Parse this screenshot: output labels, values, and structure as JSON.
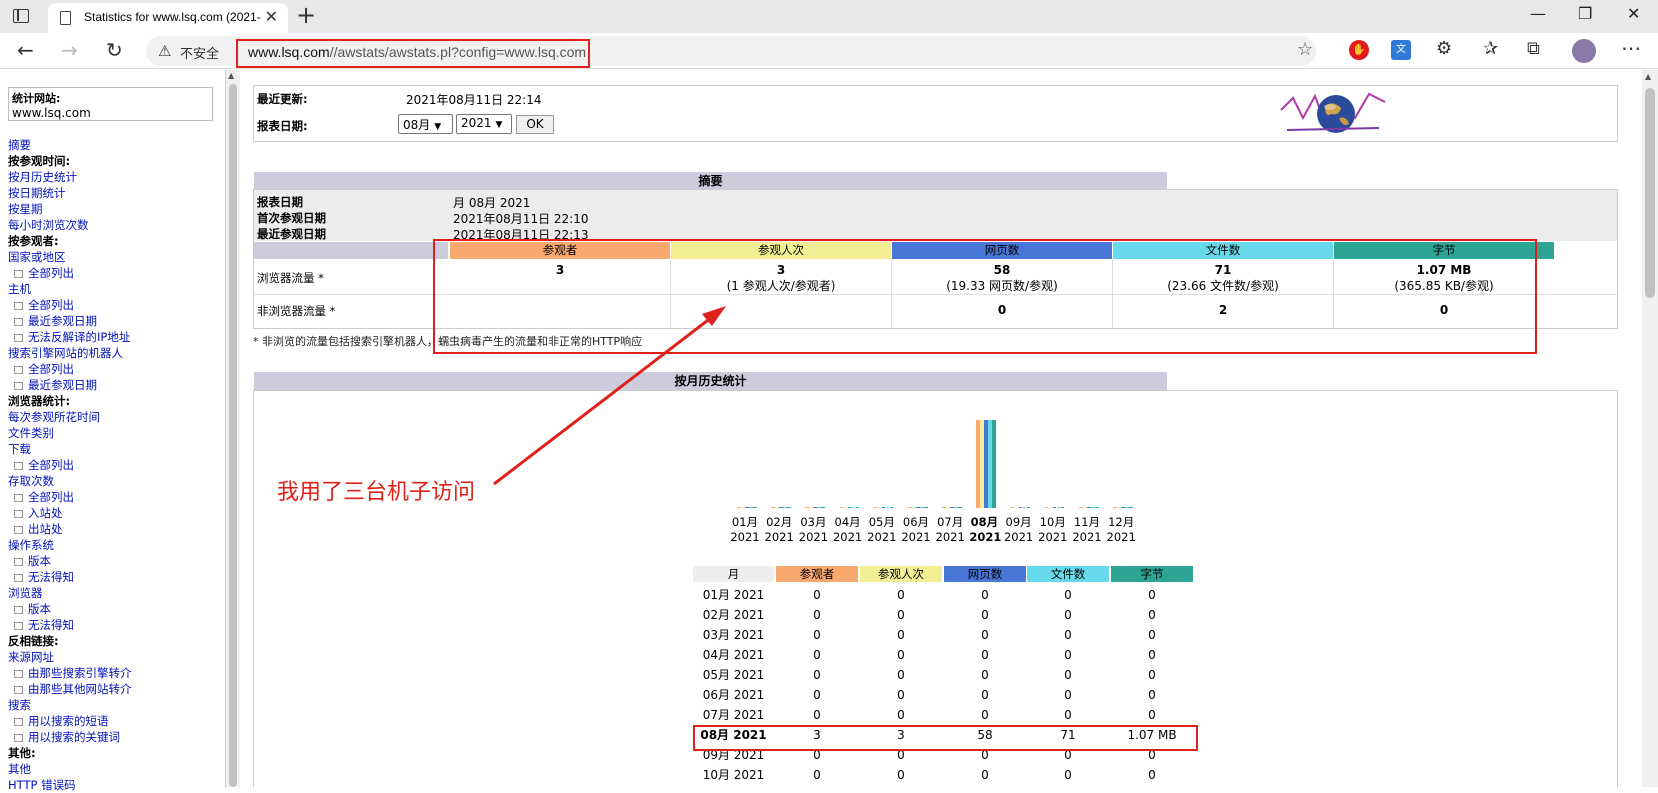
{
  "browser": {
    "tab_title": "Statistics for www.lsq.com (2021-",
    "security_label": "不安全",
    "url_host": "www.lsq.com",
    "url_path": "//awstats/awstats.pl?config=www.lsq.com"
  },
  "sidebar": {
    "site_label": "统计网站:",
    "site_value": "www.lsq.com",
    "items": [
      {
        "label": "摘要",
        "kind": "link"
      },
      {
        "label": "按参观时间:",
        "kind": "head"
      },
      {
        "label": "按月历史统计",
        "kind": "link"
      },
      {
        "label": "按日期统计",
        "kind": "link"
      },
      {
        "label": "按星期",
        "kind": "link"
      },
      {
        "label": "每小时浏览次数",
        "kind": "link"
      },
      {
        "label": "按参观者:",
        "kind": "head"
      },
      {
        "label": "国家或地区",
        "kind": "link"
      },
      {
        "label": "全部列出",
        "kind": "sub"
      },
      {
        "label": "主机",
        "kind": "link"
      },
      {
        "label": "全部列出",
        "kind": "sub"
      },
      {
        "label": "最近参观日期",
        "kind": "sub"
      },
      {
        "label": "无法反解译的IP地址",
        "kind": "sub"
      },
      {
        "label": "搜索引擎网站的机器人",
        "kind": "link"
      },
      {
        "label": "全部列出",
        "kind": "sub"
      },
      {
        "label": "最近参观日期",
        "kind": "sub"
      },
      {
        "label": "浏览器统计:",
        "kind": "head"
      },
      {
        "label": "每次参观所花时间",
        "kind": "link"
      },
      {
        "label": "文件类别",
        "kind": "link"
      },
      {
        "label": "下载",
        "kind": "link"
      },
      {
        "label": "全部列出",
        "kind": "sub"
      },
      {
        "label": "存取次数",
        "kind": "link"
      },
      {
        "label": "全部列出",
        "kind": "sub"
      },
      {
        "label": "入站处",
        "kind": "sub"
      },
      {
        "label": "出站处",
        "kind": "sub"
      },
      {
        "label": "操作系统",
        "kind": "link"
      },
      {
        "label": "版本",
        "kind": "sub"
      },
      {
        "label": "无法得知",
        "kind": "sub"
      },
      {
        "label": "浏览器",
        "kind": "link"
      },
      {
        "label": "版本",
        "kind": "sub"
      },
      {
        "label": "无法得知",
        "kind": "sub"
      },
      {
        "label": "反相链接:",
        "kind": "head"
      },
      {
        "label": "来源网址",
        "kind": "link"
      },
      {
        "label": "由那些搜索引擎转介",
        "kind": "sub"
      },
      {
        "label": "由那些其他网站转介",
        "kind": "sub"
      },
      {
        "label": "搜索",
        "kind": "link"
      },
      {
        "label": "用以搜索的短语",
        "kind": "sub"
      },
      {
        "label": "用以搜索的关键词",
        "kind": "sub"
      },
      {
        "label": "其他:",
        "kind": "head"
      },
      {
        "label": "其他",
        "kind": "link"
      },
      {
        "label": "HTTP 错误码",
        "kind": "link"
      }
    ]
  },
  "header": {
    "last_update_label": "最近更新:",
    "last_update_value": "2021年08月11日 22:14",
    "report_date_label": "报表日期:",
    "month_selected": "08月",
    "year_selected": "2021",
    "ok_label": "OK"
  },
  "summary": {
    "title": "摘要",
    "rows": [
      {
        "label": "报表日期",
        "value": "月 08月 2021"
      },
      {
        "label": "首次参观日期",
        "value": "2021年08月11日 22:10"
      },
      {
        "label": "最近参观日期",
        "value": "2021年08月11日 22:13"
      }
    ],
    "columns": [
      "参观者",
      "参观人次",
      "网页数",
      "文件数",
      "字节"
    ],
    "column_colors": [
      "#f9a86e",
      "#f2ee94",
      "#4977d8",
      "#66daea",
      "#2ea495"
    ],
    "browser_traffic_label": "浏览器流量 *",
    "browser_traffic": [
      {
        "main": "3",
        "sub": ""
      },
      {
        "main": "3",
        "sub": "(1 参观人次/参观者)"
      },
      {
        "main": "58",
        "sub": "(19.33 网页数/参观)"
      },
      {
        "main": "71",
        "sub": "(23.66 文件数/参观)"
      },
      {
        "main": "1.07 MB",
        "sub": "(365.85 KB/参观)"
      }
    ],
    "nonbrowser_traffic_label": "非浏览器流量 *",
    "nonbrowser_traffic": [
      "",
      "",
      "0",
      "2",
      "0"
    ],
    "footnote": "* 非浏览的流量包括搜索引擎机器人，蠕虫病毒产生的流量和非正常的HTTP响应"
  },
  "history": {
    "title": "按月历史统计",
    "months": [
      "01月",
      "02月",
      "03月",
      "04月",
      "05月",
      "06月",
      "07月",
      "08月",
      "09月",
      "10月",
      "11月",
      "12月"
    ],
    "year": "2021",
    "selected_index": 7,
    "table_headers": [
      "月",
      "参观者",
      "参观人次",
      "网页数",
      "文件数",
      "字节"
    ],
    "table_rows": [
      [
        "01月 2021",
        "0",
        "0",
        "0",
        "0",
        "0"
      ],
      [
        "02月 2021",
        "0",
        "0",
        "0",
        "0",
        "0"
      ],
      [
        "03月 2021",
        "0",
        "0",
        "0",
        "0",
        "0"
      ],
      [
        "04月 2021",
        "0",
        "0",
        "0",
        "0",
        "0"
      ],
      [
        "05月 2021",
        "0",
        "0",
        "0",
        "0",
        "0"
      ],
      [
        "06月 2021",
        "0",
        "0",
        "0",
        "0",
        "0"
      ],
      [
        "07月 2021",
        "0",
        "0",
        "0",
        "0",
        "0"
      ],
      [
        "08月 2021",
        "3",
        "3",
        "58",
        "71",
        "1.07 MB"
      ],
      [
        "09月 2021",
        "0",
        "0",
        "0",
        "0",
        "0"
      ],
      [
        "10月 2021",
        "0",
        "0",
        "0",
        "0",
        "0"
      ]
    ]
  },
  "annotation": {
    "text": "我用了三台机子访问"
  }
}
